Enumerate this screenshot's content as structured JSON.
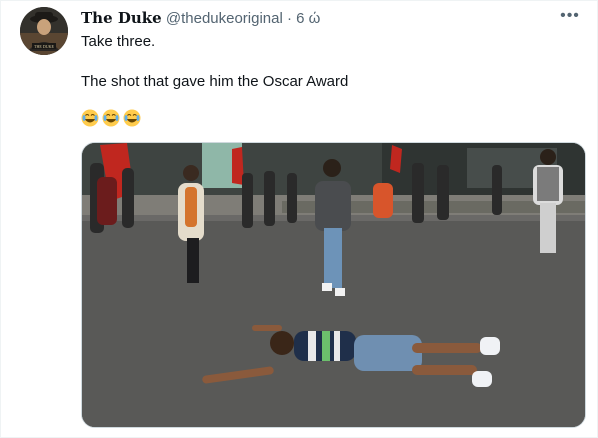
{
  "tweet": {
    "display_name": "The Duke",
    "handle": "@thedukeoriginal",
    "separator": "·",
    "time": "6 ώ",
    "more_label": "•••",
    "line1": "Take three.",
    "line2": "The shot that gave him the Oscar Award",
    "emoji_count": 3,
    "emoji": "😂"
  },
  "icons": {
    "avatar": "profile-avatar",
    "more": "more-options-icon",
    "emoji": "face-with-tears-of-joy-emoji"
  },
  "colors": {
    "text": "#0f1419",
    "secondary": "#536471",
    "border": "#eff3f4"
  }
}
